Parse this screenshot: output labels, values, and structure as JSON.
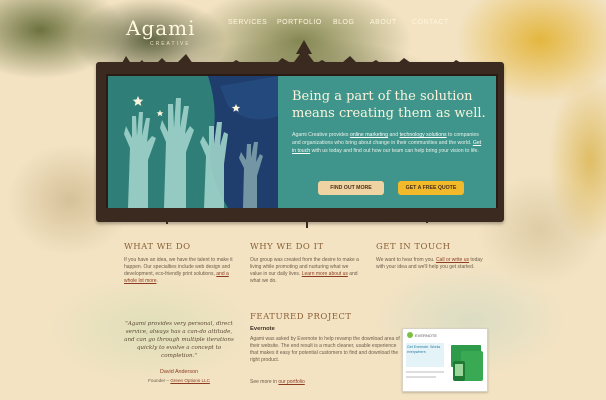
{
  "nav": {
    "logo": "Agami",
    "logo_sub": "CREATIVE",
    "items": [
      "SERVICES",
      "PORTFOLIO",
      "BLOG",
      "ABOUT",
      "CONTACT"
    ]
  },
  "banner": {
    "title": "Being a part of the solution means creating them as well.",
    "body_parts": {
      "p1": "Agami Creative provides ",
      "link1": "online marketing",
      "p2": " and ",
      "link2": "technology solutions",
      "p3": " to companies and organizations who bring about change in their communities and the world. ",
      "link3": "Get in touch",
      "p4": " with us today and find out how our team can help bring your vision to life."
    },
    "btn_learn": "FIND OUT MORE",
    "btn_quote": "GET A FREE QUOTE"
  },
  "columns": [
    {
      "heading": "WHAT WE DO",
      "text": "If you have an idea, we have the talent to make it happen. Our specialties include web design and development, eco-friendly print solutions, ",
      "link": "and a whole lot more",
      "tail": "."
    },
    {
      "heading": "WHY WE DO IT",
      "text": "Our group was created from the desire to make a living while promoting and nurturing what we value in our daily lives. ",
      "link": "Learn more about us",
      "tail": " and what we do."
    },
    {
      "heading": "GET IN TOUCH",
      "text": "We want to hear from you. ",
      "link": "Call or write us",
      "tail": " today with your idea and we'll help you get started."
    }
  ],
  "testimonial": {
    "quote": "\"Agami provides very personal, direct service, always has a can-do attitude, and can go through multiple iterations quickly to evolve a concept to completion.\"",
    "name": "David Anderson",
    "role_prefix": "Founder – ",
    "role_link": "Green Options LLC"
  },
  "featured": {
    "heading": "FEATURED PROJECT",
    "subtitle": "Evernote",
    "text": "Agami was asked by Evernote to help revamp the download area of their website. The end result is a much cleaner, usable experience that makes it easy for potential customers to find and download the right product.",
    "more_prefix": "See more in ",
    "more_link": "our portfolio",
    "thumb": {
      "brand": "EVERNOTE",
      "headline": "Get Evernote. Works everywhere."
    }
  },
  "colors": {
    "banner_teal": "#3f958b",
    "accent_orange": "#f2b92b",
    "link_rust": "#8d3c22",
    "heading_brown": "#8a5f35"
  }
}
